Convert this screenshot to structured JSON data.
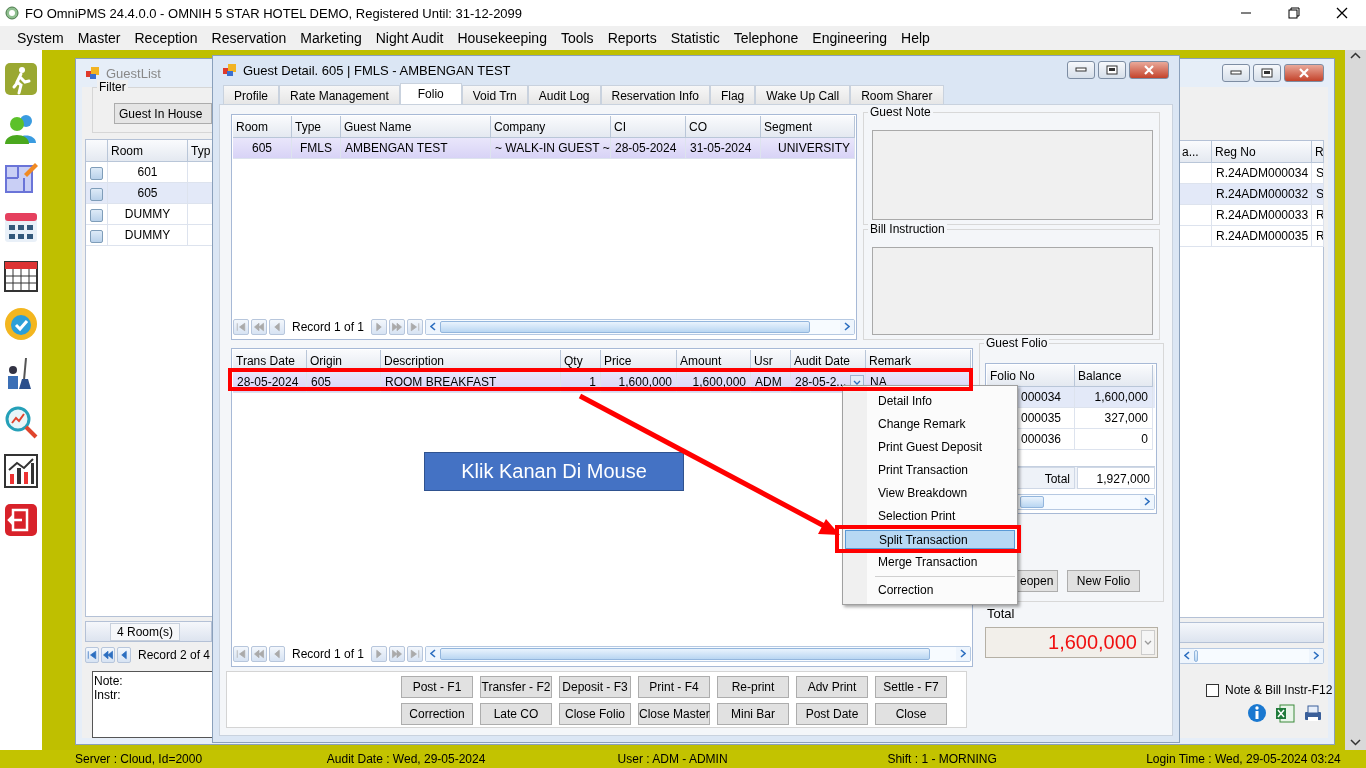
{
  "window": {
    "title": "FO OmniPMS 24.4.0.0 - OMNIH 5 STAR HOTEL DEMO, Registered Until: 31-12-2099"
  },
  "menu": [
    "System",
    "Master",
    "Reception",
    "Reservation",
    "Marketing",
    "Night Audit",
    "Housekeeping",
    "Tools",
    "Reports",
    "Statistic",
    "Telephone",
    "Engineering",
    "Help"
  ],
  "guest_list": {
    "title": "GuestList",
    "filter_label": "Filter",
    "filter_value": "Guest In House",
    "columns_left": [
      "Room",
      "Typ"
    ],
    "columns_right": [
      "a...",
      "Reg No",
      "R"
    ],
    "rows": [
      {
        "room": "601",
        "reg_no": "R.24ADM000034",
        "column_r": "S",
        "checked": false,
        "selected": false
      },
      {
        "room": "605",
        "reg_no": "R.24ADM000032",
        "column_r": "S",
        "checked": false,
        "selected": true
      },
      {
        "room": "DUMMY",
        "reg_no": "R.24ADM000033",
        "column_r": "R",
        "checked": false,
        "selected": false
      },
      {
        "room": "DUMMY",
        "reg_no": "R.24ADM000035",
        "column_r": "R",
        "checked": false,
        "selected": false
      }
    ],
    "room_count": "4 Room(s)",
    "record": "Record 2 of 4",
    "note_label": "Note:",
    "instr_label": "Instr:",
    "note_bill": {
      "label": "Note & Bill Instr-F12",
      "checked": false
    }
  },
  "guest_detail": {
    "title": "Guest Detail. 605 | FMLS - AMBENGAN TEST",
    "tabs": [
      {
        "label": "Profile",
        "selected": false
      },
      {
        "label": "Rate Management",
        "selected": false
      },
      {
        "label": "Folio",
        "selected": true
      },
      {
        "label": "Void Trn",
        "selected": false
      },
      {
        "label": "Audit Log",
        "selected": false
      },
      {
        "label": "Reservation Info",
        "selected": false
      },
      {
        "label": "Flag",
        "selected": false
      },
      {
        "label": "Wake Up Call",
        "selected": false
      },
      {
        "label": "Room Sharer",
        "selected": false
      }
    ],
    "reservation_grid": {
      "columns": [
        "Room",
        "Type",
        "Guest Name",
        "Company",
        "CI",
        "CO",
        "Segment"
      ],
      "rows": [
        {
          "cells": [
            "605",
            "FMLS",
            "AMBENGAN TEST",
            "~ WALK-IN GUEST ~",
            "28-05-2024",
            "31-05-2024",
            "UNIVERSITY"
          ],
          "selected": true
        }
      ],
      "record": "Record 1 of 1"
    },
    "guest_note_label": "Guest Note",
    "bill_instruction_label": "Bill Instruction",
    "transactions": {
      "columns": [
        "Trans Date",
        "Origin",
        "Description",
        "Qty",
        "Price",
        "Amount",
        "Usr",
        "Audit Date",
        "Remark"
      ],
      "rows": [
        {
          "cells": [
            "28-05-2024",
            "605",
            "ROOM BREAKFAST",
            "1",
            "1,600,000",
            "1,600,000",
            "ADM",
            "28-05-2...",
            "NA"
          ],
          "selected": true
        }
      ],
      "record": "Record 1 of 1"
    },
    "guest_folio": {
      "label": "Guest Folio",
      "columns": [
        "Folio No",
        "Balance"
      ],
      "rows": [
        {
          "folio_no": "000034",
          "balance": "1,600,000",
          "selected": true
        },
        {
          "folio_no": "000035",
          "balance": "327,000",
          "selected": false
        },
        {
          "folio_no": "000036",
          "balance": "0",
          "selected": false
        }
      ],
      "total_label": "Total",
      "total": "1,927,000",
      "buttons": [
        "eopen",
        "New Folio"
      ]
    },
    "total_label": "Total",
    "total_value": "1,600,000",
    "buttons": [
      [
        "Post - F1",
        "Transfer - F2",
        "Deposit - F3",
        "Print - F4",
        "Re-print",
        "Adv Print",
        "Settle - F7"
      ],
      [
        "Correction",
        "Late CO",
        "Close Folio",
        "Close Master",
        "Mini Bar",
        "Post Date",
        "Close"
      ]
    ]
  },
  "context_menu": [
    {
      "kind": "item",
      "label": "Detail Info",
      "selected": false
    },
    {
      "kind": "item",
      "label": "Change Remark",
      "selected": false
    },
    {
      "kind": "item",
      "label": "Print Guest Deposit",
      "selected": false
    },
    {
      "kind": "item",
      "label": "Print Transaction",
      "selected": false
    },
    {
      "kind": "item",
      "label": "View Breakdown",
      "selected": false
    },
    {
      "kind": "item",
      "label": "Selection Print",
      "selected": false
    },
    {
      "kind": "item",
      "label": "Split Transaction",
      "selected": true
    },
    {
      "kind": "item",
      "label": "Merge Transaction",
      "selected": false
    },
    {
      "kind": "separator"
    },
    {
      "kind": "item",
      "label": "Correction",
      "selected": false
    }
  ],
  "annotation": {
    "callout": "Klik Kanan Di Mouse"
  },
  "status_bar": [
    "Server : Cloud, Id=2000",
    "Audit Date : Wed, 29-05-2024",
    "User : ADM - ADMIN",
    "Shift : 1 - MORNING",
    "Login Time : Wed, 29-05-2024 03:24"
  ]
}
